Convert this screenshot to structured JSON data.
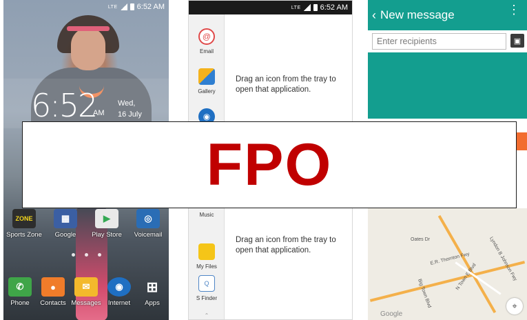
{
  "status": {
    "network": "LTE",
    "time": "6:52 AM"
  },
  "home": {
    "clock": "6:52",
    "ampm": "AM",
    "day": "Wed,",
    "date": "16 July",
    "row1": [
      {
        "label": "Sports Zone",
        "icon": "zone-icon",
        "color": "#2d2d2d"
      },
      {
        "label": "Google",
        "icon": "google-folder-icon",
        "color": "#3b5fa3"
      },
      {
        "label": "Play Store",
        "icon": "play-store-icon",
        "color": "#e9e9e9"
      },
      {
        "label": "Voicemail",
        "icon": "voicemail-icon",
        "color": "#2a6db5"
      }
    ],
    "dock": [
      {
        "label": "Phone",
        "icon": "phone-icon",
        "color": "#3fa548"
      },
      {
        "label": "Contacts",
        "icon": "contacts-icon",
        "color": "#f07c2a"
      },
      {
        "label": "Messages",
        "icon": "messages-icon",
        "color": "#f3b92c"
      },
      {
        "label": "Internet",
        "icon": "internet-icon",
        "color": "#1f6fc2"
      },
      {
        "label": "Apps",
        "icon": "apps-grid-icon",
        "color": "#555555"
      }
    ]
  },
  "tray": {
    "items": [
      {
        "label": "Email",
        "icon": "email-icon",
        "color": "#e04848"
      },
      {
        "label": "Gallery",
        "icon": "gallery-icon",
        "color": "#f4b21c"
      },
      {
        "label": "Music",
        "icon": "music-icon",
        "color": "#ffffff"
      },
      {
        "label": "My Files",
        "icon": "my-files-icon",
        "color": "#f5c518"
      },
      {
        "label": "S Finder",
        "icon": "s-finder-icon",
        "color": "#4f86c6"
      }
    ],
    "drop_hint": "Drag an icon from the tray to open that application."
  },
  "message": {
    "title": "New message",
    "recipients_placeholder": "Enter recipients",
    "map_labels": {
      "dates_dr": "Oates Dr",
      "thornton": "E.R. Thornton Fwy",
      "town_east": "N Town E Blvd",
      "big_town": "Big Town Blvd",
      "lyndon": "Lyndon B Johnson Fwy",
      "google": "Google"
    }
  },
  "overlay": {
    "text": "FPO"
  }
}
